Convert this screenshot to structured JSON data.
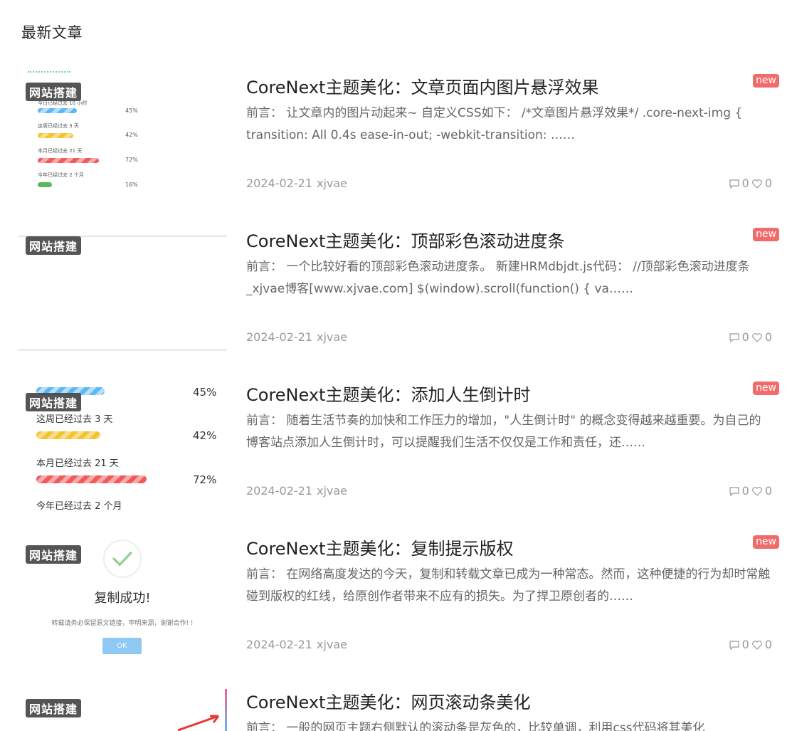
{
  "section_title": "最新文章",
  "posts": [
    {
      "category": "网站搭建",
      "title": "CoreNext主题美化：文章页面内图片悬浮效果",
      "badge": "new",
      "excerpt": "前言： 让文章内的图片动起来~ 自定义CSS如下： /*文章图片悬浮效果*/ .core-next-img { transition: All 0.4s ease-in-out; -webkit-transition: ……",
      "date": "2024-02-21",
      "author": "xjvae",
      "comments": "0",
      "likes": "0",
      "thumb": {
        "rows": [
          {
            "label": "今日已经过去 10 小时",
            "pct": "45%",
            "fill": 0.45
          },
          {
            "label": "这周已经过去 3 天",
            "pct": "42%",
            "fill": 0.42
          },
          {
            "label": "本月已经过去 21 天",
            "pct": "72%",
            "fill": 0.72
          },
          {
            "label": "今年已经过去 2 个月",
            "pct": "16%",
            "fill": 0.16
          }
        ]
      }
    },
    {
      "category": "网站搭建",
      "title": "CoreNext主题美化：顶部彩色滚动进度条",
      "badge": "new",
      "excerpt": "前言： 一个比较好看的顶部彩色滚动进度条。 新建HRMdbjdt.js代码： //顶部彩色滚动进度条_xjvae博客[www.xjvae.com] $(window).scroll(function() { va……",
      "date": "2024-02-21",
      "author": "xjvae",
      "comments": "0",
      "likes": "0"
    },
    {
      "category": "网站搭建",
      "title": "CoreNext主题美化：添加人生倒计时",
      "badge": "new",
      "excerpt": "前言： 随着生活节奏的加快和工作压力的增加，\"人生倒计时\" 的概念变得越来越重要。为自己的博客站点添加人生倒计时，可以提醒我们生活不仅仅是工作和责任，还……",
      "date": "2024-02-21",
      "author": "xjvae",
      "comments": "0",
      "likes": "0",
      "thumb": {
        "rows": [
          {
            "label": "",
            "pct": "45%",
            "fill": 0.45
          },
          {
            "label": "这周已经过去 3 天",
            "pct": "42%",
            "fill": 0.42
          },
          {
            "label": "本月已经过去 21 天",
            "pct": "72%",
            "fill": 0.72
          },
          {
            "label": "今年已经过去 2 个月",
            "pct": "",
            "fill": 0
          }
        ]
      }
    },
    {
      "category": "网站搭建",
      "title": "CoreNext主题美化：复制提示版权",
      "badge": "new",
      "excerpt": "前言： 在网络高度发达的今天，复制和转载文章已成为一种常态。然而，这种便捷的行为却时常触碰到版权的红线，给原创作者带来不应有的损失。为了捍卫原创者的……",
      "date": "2024-02-21",
      "author": "xjvae",
      "comments": "0",
      "likes": "0",
      "thumb": {
        "title": "复制成功!",
        "desc": "转载请务必保留原文链接，申明来源，谢谢合作! !",
        "button": "OK"
      }
    },
    {
      "category": "网站搭建",
      "title": "CoreNext主题美化：网页滚动条美化",
      "excerpt": "前言： 一般的网页主题右侧默认的滚动条是灰色的，比较单调，利用css代码将其美化",
      "date": "",
      "author": ""
    }
  ],
  "colors": {
    "badge": "#f26b6b",
    "tag_bg": "#464646",
    "meta": "#999999"
  }
}
